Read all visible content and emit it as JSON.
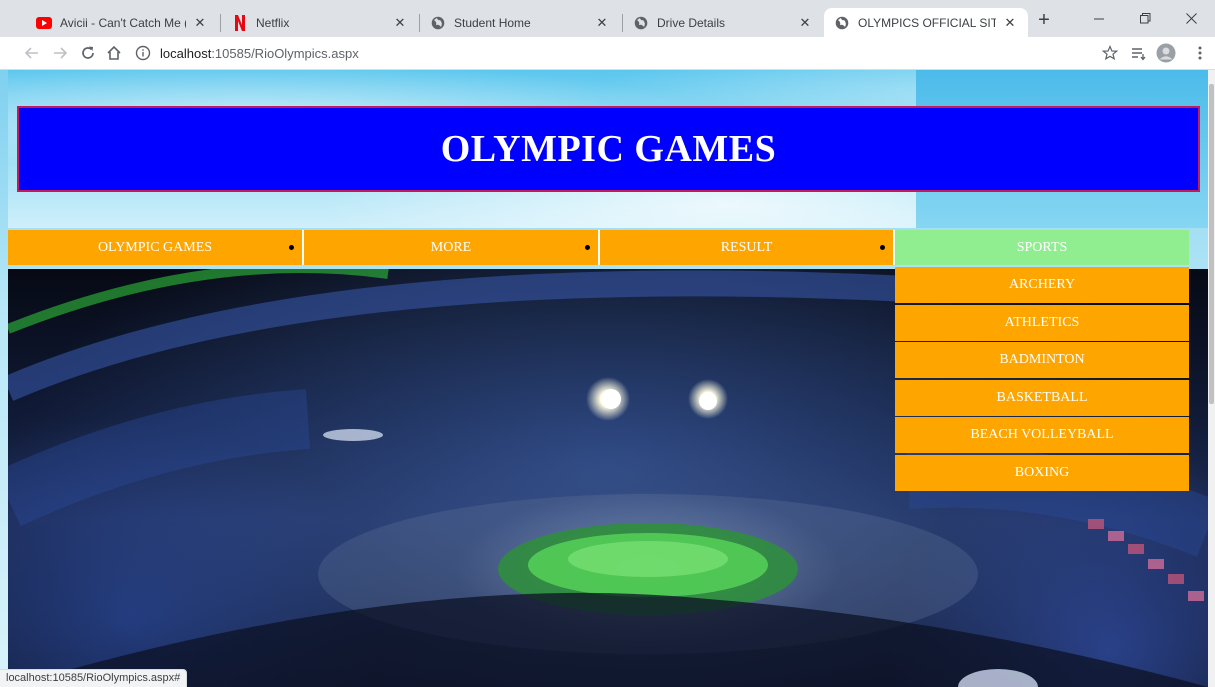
{
  "browser": {
    "tabs": [
      {
        "title": "Avicii - Can't Catch Me (Lyric V",
        "icon": "youtube-icon",
        "active": false
      },
      {
        "title": "Netflix",
        "icon": "netflix-icon",
        "active": false
      },
      {
        "title": "Student Home",
        "icon": "globe-icon",
        "active": false
      },
      {
        "title": "Drive Details",
        "icon": "globe-icon",
        "active": false
      },
      {
        "title": "OLYMPICS OFFICIAL SITE",
        "icon": "globe-icon",
        "active": true
      }
    ],
    "new_tab_label": "+",
    "address": {
      "host": "localhost",
      "rest": ":10585/RioOlympics.aspx"
    },
    "status_url": "localhost:10585/RioOlympics.aspx#"
  },
  "page": {
    "banner_title": "OLYMPIC GAMES",
    "nav": [
      {
        "label": "OLYMPIC GAMES",
        "has_submenu": true
      },
      {
        "label": "MORE",
        "has_submenu": true
      },
      {
        "label": "RESULT",
        "has_submenu": true
      },
      {
        "label": "SPORTS",
        "hovered": true
      }
    ],
    "sports_menu": [
      "ARCHERY",
      "ATHLETICS",
      "BADMINTON",
      "BASKETBALL",
      "BEACH VOLLEYBALL",
      "BOXING"
    ],
    "colors": {
      "banner_bg": "#0000ff",
      "banner_border": "#c21a5c",
      "menu_bg": "#ffa500",
      "menu_hover_bg": "#90ee90"
    }
  }
}
